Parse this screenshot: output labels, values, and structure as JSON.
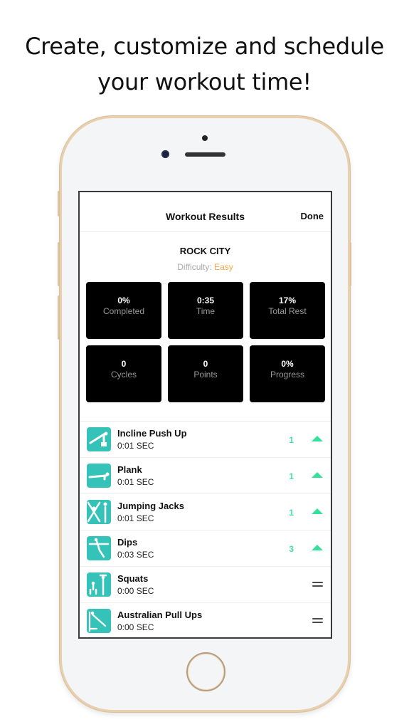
{
  "headline": {
    "line1": "Create, customize and schedule",
    "line2": "your workout time!"
  },
  "navbar": {
    "title": "Workout Results",
    "done_label": "Done"
  },
  "workout": {
    "name": "ROCK CITY",
    "difficulty_label": "Difficulty:",
    "difficulty_value": "Easy"
  },
  "stats": [
    {
      "value": "0%",
      "label": "Completed"
    },
    {
      "value": "0:35",
      "label": "Time"
    },
    {
      "value": "17%",
      "label": "Total Rest"
    },
    {
      "value": "0",
      "label": "Cycles"
    },
    {
      "value": "0",
      "label": "Points"
    },
    {
      "value": "0%",
      "label": "Progress"
    }
  ],
  "exercises": [
    {
      "name": "Incline Push Up",
      "time": "0:01 SEC",
      "count": "1",
      "trend": "up",
      "icon": "incline-push-up-icon"
    },
    {
      "name": "Plank",
      "time": "0:01 SEC",
      "count": "1",
      "trend": "up",
      "icon": "plank-icon"
    },
    {
      "name": "Jumping Jacks",
      "time": "0:01 SEC",
      "count": "1",
      "trend": "up",
      "icon": "jumping-jacks-icon"
    },
    {
      "name": "Dips",
      "time": "0:03 SEC",
      "count": "3",
      "trend": "up",
      "icon": "dips-icon"
    },
    {
      "name": "Squats",
      "time": "0:00 SEC",
      "count": "",
      "trend": "equal",
      "icon": "squats-icon"
    },
    {
      "name": "Australian Pull Ups",
      "time": "0:00 SEC",
      "count": "",
      "trend": "equal",
      "icon": "australian-pull-ups-icon"
    }
  ],
  "colors": {
    "accent_teal": "#35c2b8",
    "trend_green": "#35e09a",
    "difficulty_orange": "#f1a84a",
    "phone_frame_gold": "#e8cfae"
  }
}
